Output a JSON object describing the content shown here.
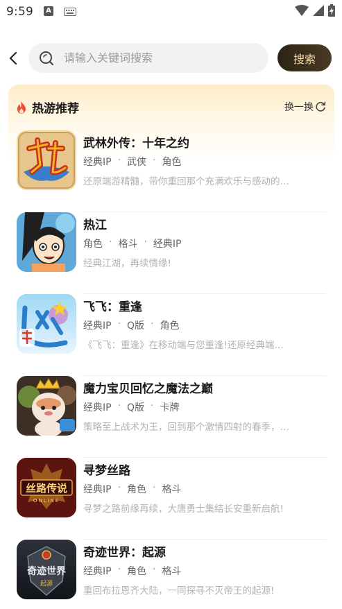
{
  "status_bar": {
    "time": "9:59",
    "icons": [
      "a-icon",
      "keyboard-icon",
      "wifi-icon",
      "signal-icon",
      "battery-charging-icon"
    ]
  },
  "search": {
    "placeholder": "请输入关键词搜索",
    "value": "",
    "button_label": "搜索"
  },
  "section": {
    "title": "热游推荐",
    "refresh_label": "换一换",
    "accent_color": "#f04a3a"
  },
  "games": [
    {
      "name": "武林外传：十年之约",
      "tags": [
        "经典IP",
        "武侠",
        "角色"
      ],
      "desc": "还原端游精髓，带你重回那个充满欢乐与感动的…",
      "icon": "wulin-icon"
    },
    {
      "name": "热江",
      "tags": [
        "角色",
        "格斗",
        "经典IP"
      ],
      "desc": "经典江湖，再续情缘!",
      "icon": "rejiang-icon"
    },
    {
      "name": "飞飞：重逢",
      "tags": [
        "经典IP",
        "Q版",
        "角色"
      ],
      "desc": "《飞飞：重逢》在移动端与您重逢!还原经典端…",
      "icon": "feifei-icon"
    },
    {
      "name": "魔力宝贝回忆之魔法之巅",
      "tags": [
        "经典IP",
        "Q版",
        "卡牌"
      ],
      "desc": "策略至上战术为王，回到那个激情四射的春季，…",
      "icon": "moli-icon"
    },
    {
      "name": "寻梦丝路",
      "tags": [
        "经典IP",
        "角色",
        "格斗"
      ],
      "desc": "寻梦之路前缘再续，大唐勇士集结长安重新启航!",
      "icon": "silu-icon",
      "icon_text": "丝路传说",
      "icon_subtext": "ONLINE"
    },
    {
      "name": "奇迹世界：起源",
      "tags": [
        "经典IP",
        "角色",
        "格斗"
      ],
      "desc": "重回布拉恩齐大陆，一同探寻不灭帝王的起源!",
      "icon": "qiji-icon",
      "icon_text": "奇迹世界",
      "icon_subtext": "起源"
    }
  ]
}
